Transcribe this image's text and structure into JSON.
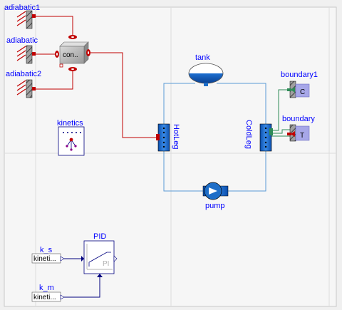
{
  "diagram": {
    "components": {
      "adiabatic1": "adiabatic1",
      "adiabatic": "adiabatic",
      "adiabatic2": "adiabatic2",
      "conduction": "con..",
      "tank": "tank",
      "boundary1": "boundary1",
      "boundary1_port": "C",
      "boundary": "boundary",
      "boundary_port": "T",
      "kinetics": "kinetics",
      "hotleg": "HotLeg",
      "coldleg": "ColdLeg",
      "pump": "pump",
      "pid": "PID",
      "pid_mode": "PI",
      "k_s": "k_s",
      "k_s_value": "kineti...",
      "k_m": "k_m",
      "k_m_value": "kineti..."
    }
  },
  "colors": {
    "background": "#f0f0f0",
    "canvas": "#f4f4f4",
    "grid": "#d8d8d8",
    "label": "#0000ff",
    "thermal_wire": "#c00000",
    "fluid_pipe": "#5b9bd5",
    "pipe_block": "#1e6ec8",
    "signal_wire": "#00007f",
    "green_wire": "#2e8b57"
  }
}
